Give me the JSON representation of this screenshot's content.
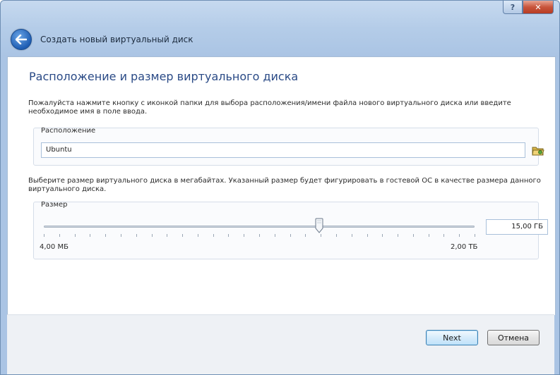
{
  "window": {
    "title": "Создать новый виртуальный диск",
    "help_glyph": "?",
    "close_glyph": "✕"
  },
  "page": {
    "heading": "Расположение и размер виртуального диска",
    "location_description": "Пожалуйста нажмите кнопку с иконкой папки для выбора расположения/имени файла нового виртуального диска или введите необходимое имя в поле ввода.",
    "location_label": "Расположение",
    "location_value": "Ubuntu",
    "size_description": "Выберите размер виртуального диска в мегабайтах. Указанный размер будет фигурировать в гостевой ОС в качестве размера данного виртуального диска.",
    "size_label": "Размер",
    "size_value": "15,00 ГБ",
    "slider_min_label": "4,00 МБ",
    "slider_max_label": "2,00 ТБ",
    "slider_position": 0.64
  },
  "footer": {
    "next_label": "Next",
    "cancel_label": "Отмена"
  },
  "icons": {
    "back": "back-arrow-icon",
    "folder": "folder-icon"
  },
  "colors": {
    "heading": "#2a4a86",
    "accent": "#1e5db3"
  }
}
